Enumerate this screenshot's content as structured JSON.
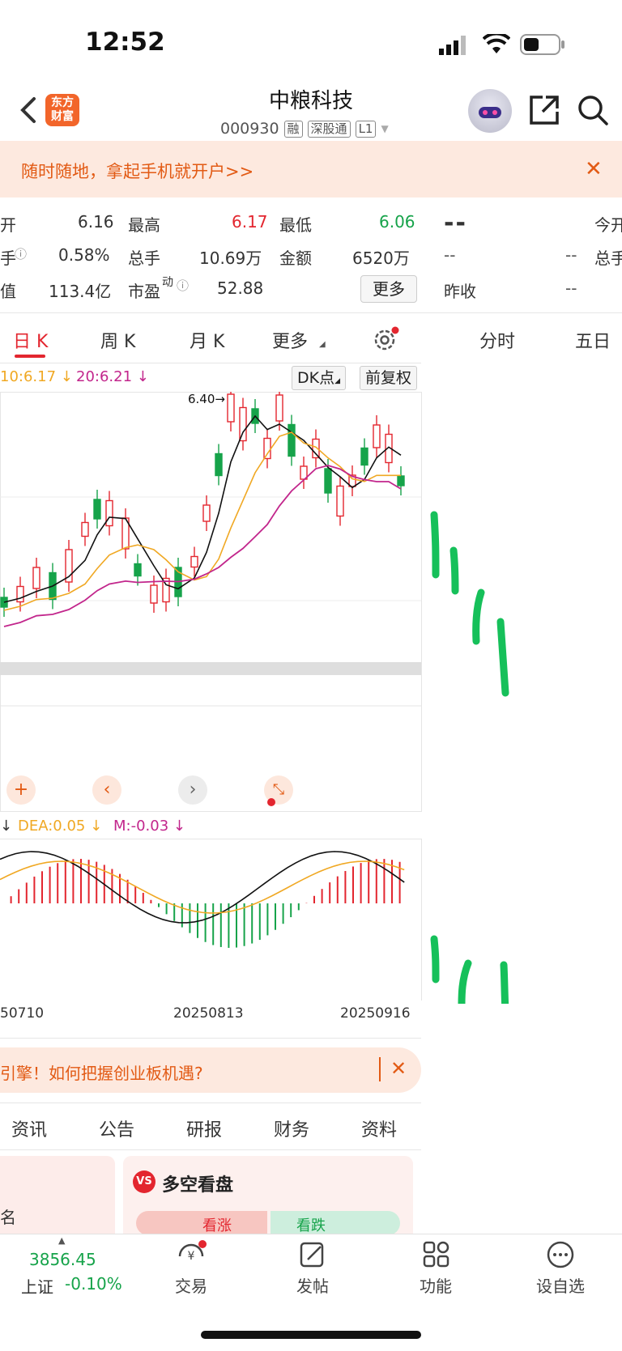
{
  "status_bar": {
    "time": "12:52"
  },
  "header": {
    "logo_text": "东方\n财富",
    "stock_name": "中粮科技",
    "stock_code": "000930",
    "tags": [
      "融",
      "深股通",
      "L1"
    ]
  },
  "banner": {
    "text": "随时随地，拿起手机就开户>>"
  },
  "quote": {
    "open_label": "开",
    "open": "6.16",
    "high_label": "最高",
    "high": "6.17",
    "low_label": "最低",
    "low": "6.06",
    "turnover_label": "手",
    "turnover": "0.58%",
    "volume_label": "总手",
    "volume": "10.69万",
    "amount_label": "金额",
    "amount": "6520万",
    "mcap_label": "值",
    "mcap": "113.4亿",
    "pe_label": "市盈",
    "pe_sup": "动",
    "pe": "52.88",
    "more_button": "更多",
    "right_main": "--",
    "right_open_label": "今开",
    "right_total_label": "总手",
    "right_dash1": "--",
    "right_dash2": "--",
    "prev_close_label": "昨收",
    "prev_close": "--"
  },
  "kline_tabs": [
    "日 K",
    "周 K",
    "月 K",
    "更多"
  ],
  "side_tabs": [
    "分时",
    "五日"
  ],
  "ma_labels": {
    "ma10": "10:6.17 ↓",
    "ma20": "20:6.21 ↓"
  },
  "chart_chips": {
    "dk": "DK点",
    "adjust": "前复权"
  },
  "peak_label": "6.40→",
  "macd_labels": {
    "dea": "DEA:0.05 ↓",
    "m": "M:-0.03 ↓"
  },
  "x_dates": [
    "50710",
    "20250813",
    "20250916"
  ],
  "news_banner": "引擎！如何把握创业板机遇?",
  "info_tabs": [
    "资讯",
    "公告",
    "研报",
    "财务",
    "资料"
  ],
  "card": {
    "title": "多空看盘",
    "bull": "看涨",
    "bear": "看跌",
    "left_label": "名"
  },
  "bottom_bar": {
    "index_value": "3856.45",
    "index_name": "上证",
    "index_change": "-0.10%",
    "items": [
      "交易",
      "发帖",
      "功能",
      "设自选"
    ]
  },
  "colors": {
    "up": "#e3262f",
    "down": "#16a34a",
    "accent": "#f2652a",
    "ma5": "#111111",
    "ma10": "#f0a823",
    "ma20": "#c2268c"
  },
  "chart_data": {
    "type": "candlestick",
    "annotations": [
      "6.40→"
    ],
    "series": [
      {
        "name": "10:6.17",
        "color": "#f0a823"
      },
      {
        "name": "20:6.21",
        "color": "#c2268c"
      }
    ],
    "macd_series": [
      {
        "name": "DEA:0.05",
        "color": "#f0a823"
      },
      {
        "name": "M:-0.03",
        "color": "#c2268c"
      }
    ],
    "x_ticks": [
      "50710",
      "20250813",
      "20250916"
    ]
  }
}
